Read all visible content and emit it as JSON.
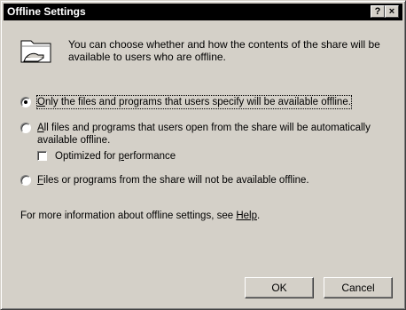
{
  "window": {
    "title": "Offline Settings",
    "help_button": "?",
    "close_button": "×"
  },
  "intro": {
    "icon": "shared-folder-icon",
    "text": "You can choose whether and how the contents of the share will be available to users who are offline."
  },
  "options": {
    "specify": {
      "mnemonic": "O",
      "rest": "nly the files and programs that users specify will be available offline.",
      "checked": true
    },
    "all": {
      "mnemonic": "A",
      "rest": "ll files and programs that users open from the share will be automatically",
      "line2": "available offline.",
      "checked": false
    },
    "optimized": {
      "prefix": "Optimized for ",
      "mnemonic": "p",
      "rest": "erformance",
      "checked": false
    },
    "none": {
      "mnemonic": "F",
      "rest": "iles or programs from the share will not be available offline.",
      "checked": false
    }
  },
  "more_info": {
    "text": "For more information about offline settings, see ",
    "link": "Help",
    "suffix": "."
  },
  "buttons": {
    "ok": "OK",
    "cancel": "Cancel"
  },
  "colors": {
    "dialog_bg": "#d4d0c8",
    "titlebar_bg": "#000000",
    "titlebar_text": "#ffffff"
  }
}
